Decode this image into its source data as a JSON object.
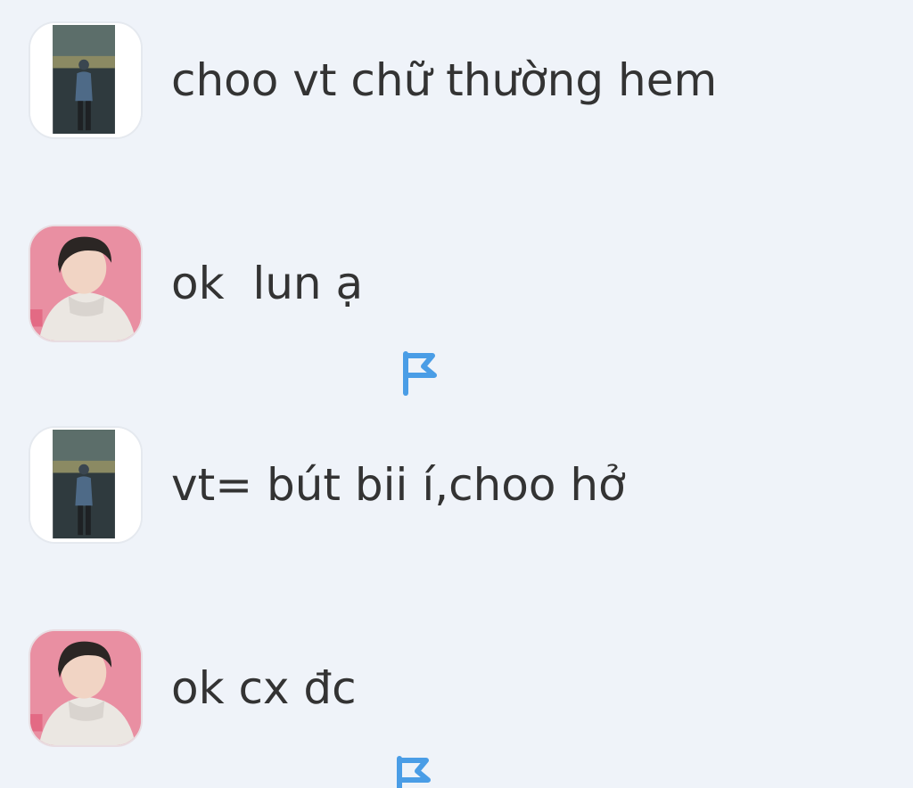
{
  "messages": [
    {
      "text": "choo vt chữ thường hem",
      "avatar": "user-a",
      "flag": false
    },
    {
      "text": "ok  lun ạ",
      "avatar": "user-b",
      "flag": true
    },
    {
      "text": "vt= bút bii í,choo hở",
      "avatar": "user-a",
      "flag": false
    },
    {
      "text": "ok cx đc",
      "avatar": "user-b",
      "flag": true
    }
  ],
  "colors": {
    "background": "#eff3f9",
    "text": "#333333",
    "flag": "#4a9de6"
  },
  "icons": {
    "flag": "flag-icon"
  }
}
